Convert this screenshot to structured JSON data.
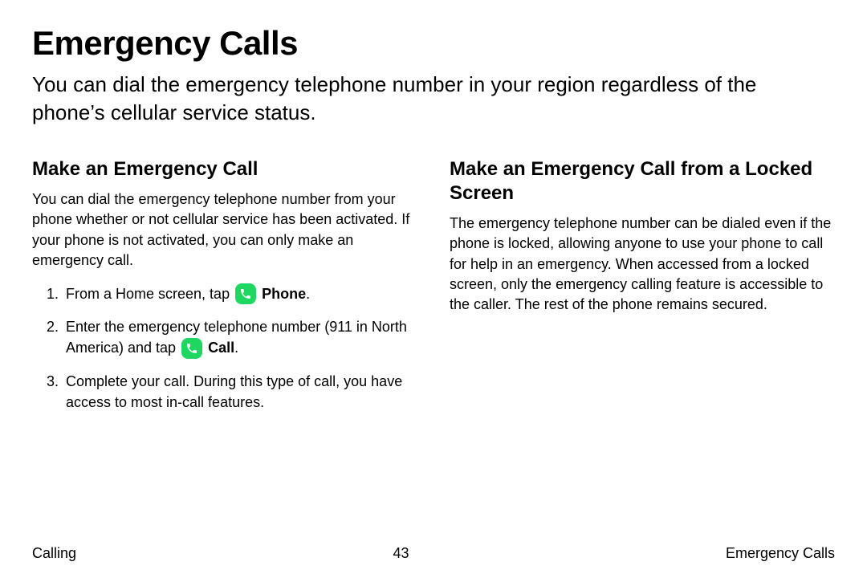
{
  "title": "Emergency Calls",
  "intro": "You can dial the emergency telephone number in your region regardless of the phone’s cellular service status.",
  "left": {
    "heading": "Make an Emergency Call",
    "body": "You can dial the emergency telephone number from your phone whether or not cellular service has been activated. If your phone is not activated, you can only make an emergency call.",
    "step1_pre": "From a Home screen, tap ",
    "step1_label": "Phone",
    "step1_post": ".",
    "step2_pre": "Enter the emergency telephone number (911 in North America) and tap ",
    "step2_label": "Call",
    "step2_post": ".",
    "step3": "Complete your call. During this type of call, you have access to most in-call features."
  },
  "right": {
    "heading": "Make an Emergency Call from a Locked Screen",
    "body": "The emergency telephone number can be dialed even if the phone is locked, allowing anyone to use your phone to call for help in an emergency. When accessed from a locked screen, only the emergency calling feature is accessible to the caller. The rest of the phone remains secured."
  },
  "footer": {
    "left": "Calling",
    "center": "43",
    "right": "Emergency Calls"
  }
}
